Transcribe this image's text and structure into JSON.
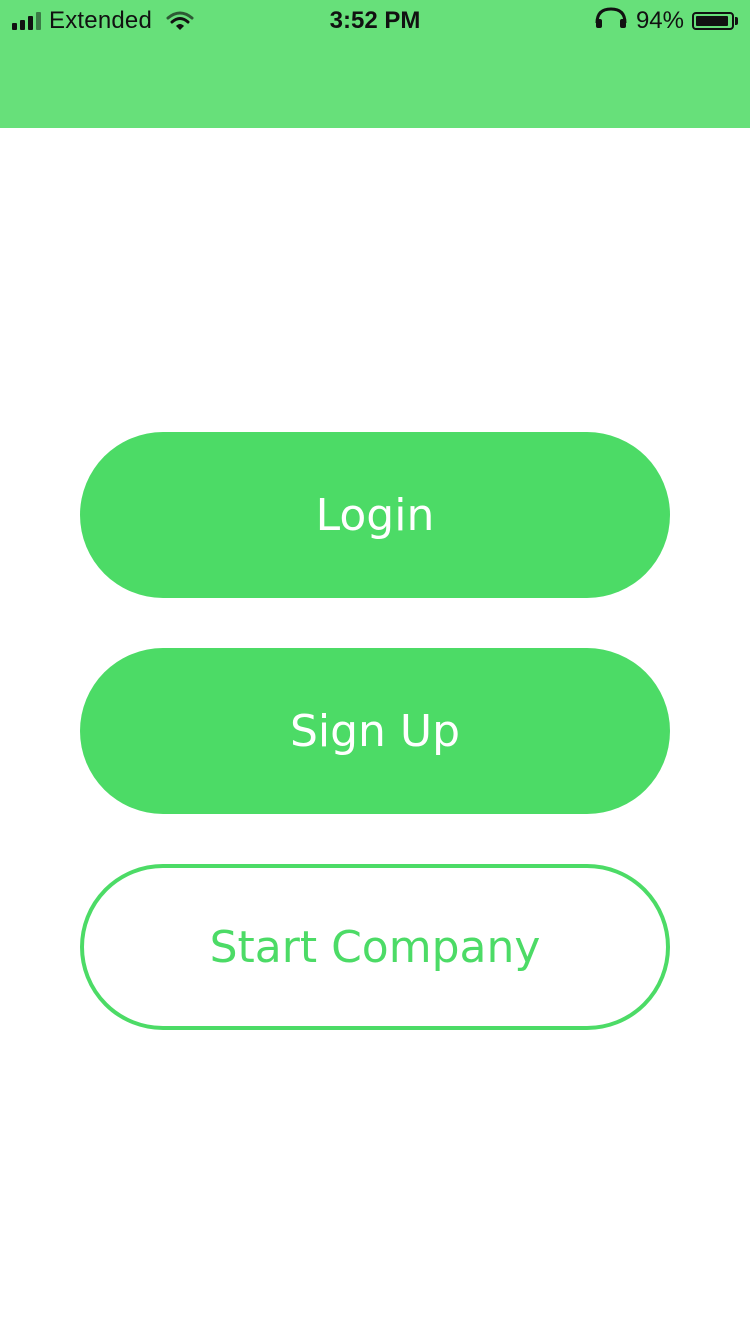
{
  "status_bar": {
    "carrier": "Extended",
    "time": "3:52 PM",
    "battery_percent": "94%",
    "battery_level": 0.94,
    "icons": [
      "signal-icon",
      "wifi-icon",
      "headphones-icon",
      "battery-icon"
    ]
  },
  "header": {
    "color": "#67e07a"
  },
  "buttons": {
    "login_label": "Login",
    "signup_label": "Sign Up",
    "start_company_label": "Start Company"
  },
  "colors": {
    "accent": "#4cdb66",
    "background": "#ffffff"
  }
}
